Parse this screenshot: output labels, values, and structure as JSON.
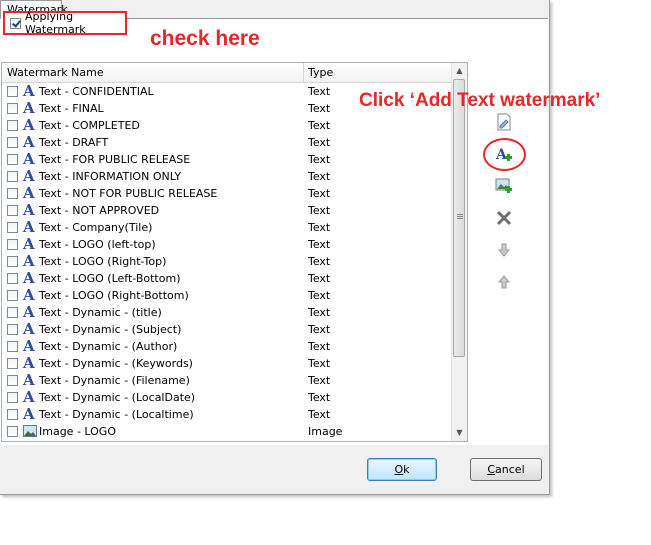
{
  "tab": {
    "label": "Watermark"
  },
  "apply_checkbox": {
    "label": "Applying Watermark",
    "checked": true
  },
  "annotations": {
    "check_here": "check here",
    "click_add_text": "Click ‘Add Text watermark’",
    "color": "#e8262b"
  },
  "list": {
    "columns": {
      "name": "Watermark Name",
      "type": "Type"
    },
    "rows": [
      {
        "icon": "text-icon",
        "name": "Text - CONFIDENTIAL",
        "type": "Text"
      },
      {
        "icon": "text-icon",
        "name": "Text - FINAL",
        "type": "Text"
      },
      {
        "icon": "text-icon",
        "name": "Text - COMPLETED",
        "type": "Text"
      },
      {
        "icon": "text-icon",
        "name": "Text - DRAFT",
        "type": "Text"
      },
      {
        "icon": "text-icon",
        "name": "Text - FOR PUBLIC RELEASE",
        "type": "Text"
      },
      {
        "icon": "text-icon",
        "name": "Text - INFORMATION ONLY",
        "type": "Text"
      },
      {
        "icon": "text-icon",
        "name": "Text - NOT FOR PUBLIC RELEASE",
        "type": "Text"
      },
      {
        "icon": "text-icon",
        "name": "Text - NOT APPROVED",
        "type": "Text"
      },
      {
        "icon": "text-icon",
        "name": "Text - Company(Tile)",
        "type": "Text"
      },
      {
        "icon": "text-icon",
        "name": "Text - LOGO (left-top)",
        "type": "Text"
      },
      {
        "icon": "text-icon",
        "name": "Text - LOGO (Right-Top)",
        "type": "Text"
      },
      {
        "icon": "text-icon",
        "name": "Text - LOGO (Left-Bottom)",
        "type": "Text"
      },
      {
        "icon": "text-icon",
        "name": "Text - LOGO (Right-Bottom)",
        "type": "Text"
      },
      {
        "icon": "text-icon",
        "name": "Text - Dynamic - (title)",
        "type": "Text"
      },
      {
        "icon": "text-icon",
        "name": "Text - Dynamic - (Subject)",
        "type": "Text"
      },
      {
        "icon": "text-icon",
        "name": "Text - Dynamic - (Author)",
        "type": "Text"
      },
      {
        "icon": "text-icon",
        "name": "Text - Dynamic - (Keywords)",
        "type": "Text"
      },
      {
        "icon": "text-icon",
        "name": "Text - Dynamic - (Filename)",
        "type": "Text"
      },
      {
        "icon": "text-icon",
        "name": "Text - Dynamic - (LocalDate)",
        "type": "Text"
      },
      {
        "icon": "text-icon",
        "name": "Text - Dynamic - (Localtime)",
        "type": "Text"
      },
      {
        "icon": "image-icon",
        "name": "Image - LOGO",
        "type": "Image"
      }
    ]
  },
  "toolbar": {
    "items": [
      {
        "name": "edit-watermark-icon"
      },
      {
        "name": "add-text-watermark-icon"
      },
      {
        "name": "add-image-watermark-icon"
      },
      {
        "name": "delete-icon"
      },
      {
        "name": "move-down-icon"
      },
      {
        "name": "move-up-icon"
      }
    ]
  },
  "buttons": {
    "ok": {
      "mnemonic": "O",
      "rest": "k"
    },
    "cancel": {
      "mnemonic": "C",
      "rest": "ancel"
    }
  }
}
